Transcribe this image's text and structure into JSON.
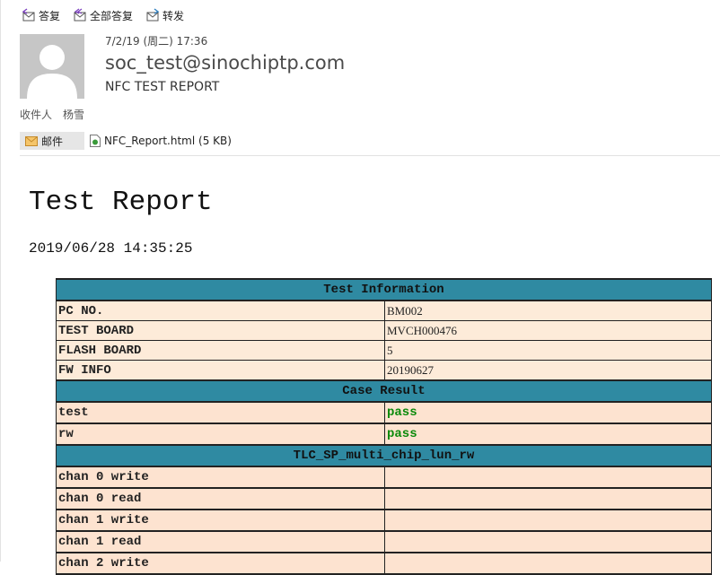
{
  "toolbar": {
    "reply": "答复",
    "reply_all": "全部答复",
    "forward": "转发"
  },
  "message": {
    "date": "7/2/19 (周二) 17:36",
    "sender": "soc_test@sinochiptp.com",
    "subject": "NFC TEST REPORT",
    "to_label": "收件人",
    "to_name": "杨雪"
  },
  "attachments": {
    "mail_tab": "邮件",
    "file": "NFC_Report.html (5 KB)"
  },
  "report": {
    "title": "Test Report",
    "datetime": "2019/06/28 14:35:25",
    "sections": {
      "info": "Test Information",
      "case": "Case Result",
      "test": "TLC_SP_multi_chip_lun_rw"
    },
    "info_rows": [
      {
        "key": "PC NO.",
        "value": "BM002"
      },
      {
        "key": "TEST BOARD",
        "value": "MVCH000476"
      },
      {
        "key": "FLASH BOARD",
        "value": "5"
      },
      {
        "key": "FW INFO",
        "value": "20190627"
      }
    ],
    "case_rows": [
      {
        "key": "test",
        "value": "pass"
      },
      {
        "key": "rw",
        "value": "pass"
      }
    ],
    "chan_rows": [
      {
        "key": "chan 0 write",
        "value": ""
      },
      {
        "key": "chan 0 read",
        "value": ""
      },
      {
        "key": "chan 1 write",
        "value": ""
      },
      {
        "key": "chan 1 read",
        "value": ""
      },
      {
        "key": "chan 2 write",
        "value": ""
      }
    ]
  },
  "colors": {
    "section_header": "#2f8aa2",
    "info_row": "#fdebd9",
    "case_row": "#fde3d0",
    "pass_text": "#0a8a0a"
  }
}
